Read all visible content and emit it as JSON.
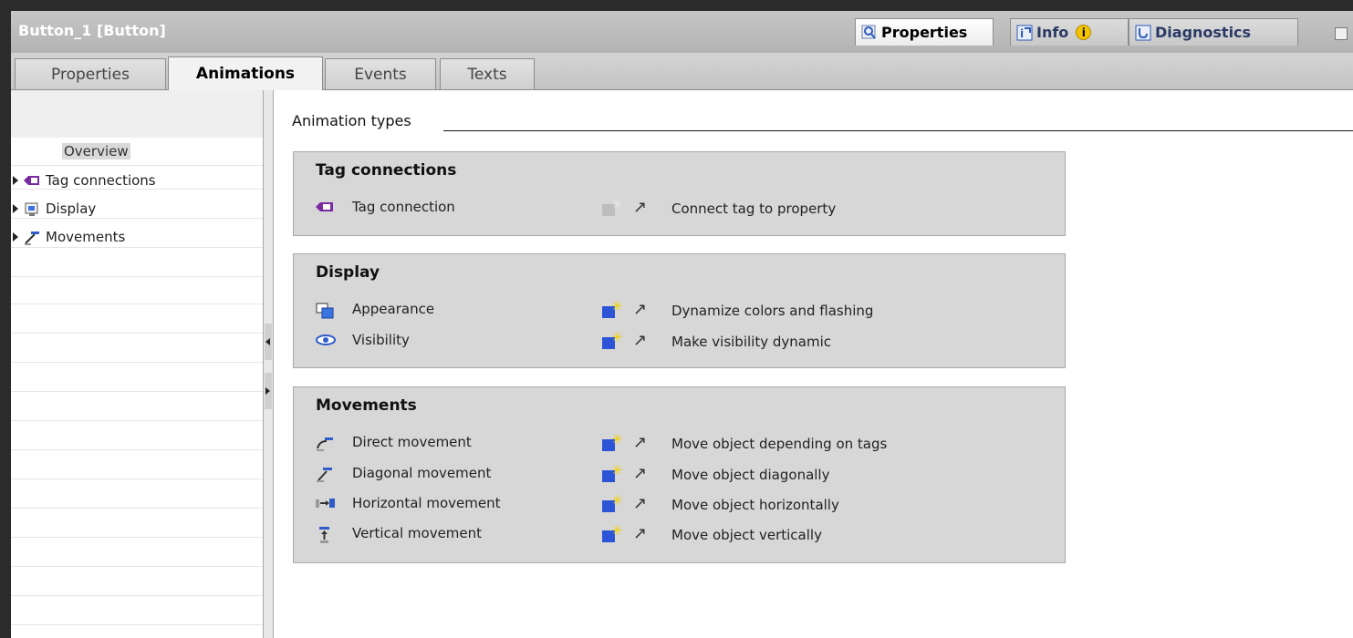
{
  "window": {
    "title": "Button_1 [Button]",
    "tabs": [
      {
        "label": "Properties",
        "icon": "magnifier-icon",
        "active": true
      },
      {
        "label": "Info",
        "icon": "info-icon",
        "active": false
      },
      {
        "label": "Diagnostics",
        "icon": "diagnostics-icon",
        "active": false
      }
    ],
    "info_badge": "i"
  },
  "subtabs": [
    {
      "label": "Properties",
      "active": false
    },
    {
      "label": "Animations",
      "active": true
    },
    {
      "label": "Events",
      "active": false
    },
    {
      "label": "Texts",
      "active": false
    }
  ],
  "tree": {
    "overview": "Overview",
    "items": [
      {
        "label": "Tag connections",
        "icon": "tag-icon"
      },
      {
        "label": "Display",
        "icon": "display-icon"
      },
      {
        "label": "Movements",
        "icon": "movement-icon"
      }
    ]
  },
  "main": {
    "heading": "Animation types",
    "groups": [
      {
        "title": "Tag connections",
        "rows": [
          {
            "name": "Tag connection",
            "icon": "tag-icon",
            "add_enabled": false,
            "desc": "Connect tag to property"
          }
        ]
      },
      {
        "title": "Display",
        "rows": [
          {
            "name": "Appearance",
            "icon": "appearance-icon",
            "add_enabled": true,
            "desc": "Dynamize colors and flashing"
          },
          {
            "name": "Visibility",
            "icon": "eye-icon",
            "add_enabled": true,
            "desc": "Make visibility dynamic"
          }
        ]
      },
      {
        "title": "Movements",
        "rows": [
          {
            "name": "Direct movement",
            "icon": "direct-movement-icon",
            "add_enabled": true,
            "desc": "Move object depending on tags"
          },
          {
            "name": "Diagonal movement",
            "icon": "diagonal-movement-icon",
            "add_enabled": true,
            "desc": "Move object diagonally"
          },
          {
            "name": "Horizontal movement",
            "icon": "horizontal-movement-icon",
            "add_enabled": true,
            "desc": "Move object horizontally"
          },
          {
            "name": "Vertical movement",
            "icon": "vertical-movement-icon",
            "add_enabled": true,
            "desc": "Move object vertically"
          }
        ]
      }
    ]
  },
  "colors": {
    "accent_blue": "#2b55d6",
    "tag_purple": "#7a2aa0",
    "group_bg": "#d7d7d7",
    "star_yellow": "#f3d100"
  }
}
